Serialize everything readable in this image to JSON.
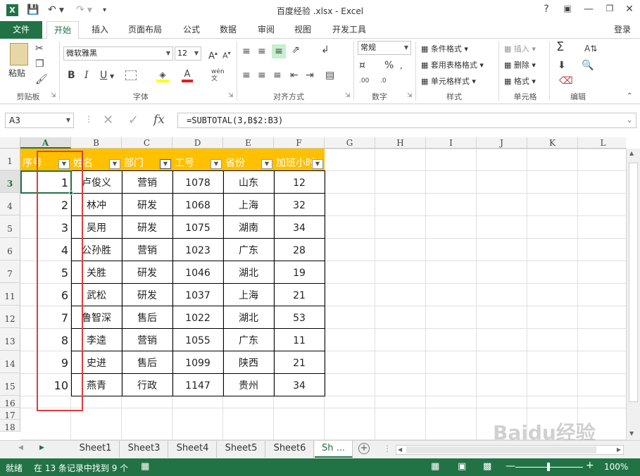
{
  "window": {
    "title": "百度经验 .xlsx - Excel",
    "help": "?",
    "controls": [
      "☐",
      "—",
      "☐",
      "✕"
    ]
  },
  "ribbon_tabs": [
    "文件",
    "开始",
    "插入",
    "页面布局",
    "公式",
    "数据",
    "审阅",
    "视图",
    "开发工具"
  ],
  "login": "登录",
  "ribbon": {
    "paste": "粘贴",
    "clipboard": "剪贴板",
    "font_name": "微软雅黑",
    "font_size": "12",
    "font_group": "字体",
    "bold": "B",
    "italic": "I",
    "underline": "U",
    "align_group": "对齐方式",
    "number_format": "常规",
    "number_group": "数字",
    "cond_format": "条件格式",
    "table_format": "套用表格格式",
    "cell_style": "单元格样式",
    "styles_group": "样式",
    "insert": "插入",
    "delete": "删除",
    "format": "格式",
    "cells_group": "单元格",
    "editing_group": "编辑"
  },
  "formula_bar": {
    "name_box": "A3",
    "fx": "fx",
    "formula": "=SUBTOTAL(3,B$2:B3)"
  },
  "grid": {
    "columns": [
      "A",
      "B",
      "C",
      "D",
      "E",
      "F",
      "G",
      "H",
      "I",
      "J",
      "K",
      "L"
    ],
    "selected_column": "A",
    "row_numbers": [
      "1",
      "3",
      "4",
      "5",
      "6",
      "7",
      "11",
      "12",
      "13",
      "14",
      "15",
      "16",
      "17",
      "18"
    ],
    "selected_row": "3",
    "header": [
      "序号",
      "姓名",
      "部门",
      "工号",
      "省份",
      "加班小时"
    ],
    "rows": [
      [
        "1",
        "卢俊义",
        "营销",
        "1078",
        "山东",
        "12"
      ],
      [
        "2",
        "林冲",
        "研发",
        "1068",
        "上海",
        "32"
      ],
      [
        "3",
        "吴用",
        "研发",
        "1075",
        "湖南",
        "34"
      ],
      [
        "4",
        "公孙胜",
        "营销",
        "1023",
        "广东",
        "28"
      ],
      [
        "5",
        "关胜",
        "研发",
        "1046",
        "湖北",
        "19"
      ],
      [
        "6",
        "武松",
        "研发",
        "1037",
        "上海",
        "21"
      ],
      [
        "7",
        "鲁智深",
        "售后",
        "1022",
        "湖北",
        "53"
      ],
      [
        "8",
        "李逵",
        "营销",
        "1055",
        "广东",
        "11"
      ],
      [
        "9",
        "史进",
        "售后",
        "1099",
        "陕西",
        "21"
      ],
      [
        "10",
        "燕青",
        "行政",
        "1147",
        "贵州",
        "34"
      ]
    ]
  },
  "sheet_tabs": [
    "Sheet1",
    "Sheet3",
    "Sheet4",
    "Sheet5",
    "Sheet6",
    "Sh ..."
  ],
  "status": {
    "mode": "就绪",
    "filter_msg": "在 13 条记录中找到 9 个",
    "zoom": "100%"
  },
  "colors": {
    "excel_green": "#217346",
    "header_fill": "#ffc000",
    "highlight_box": "#e03c3c"
  },
  "watermark": "Baidu经验 jingyan.baidu.com"
}
